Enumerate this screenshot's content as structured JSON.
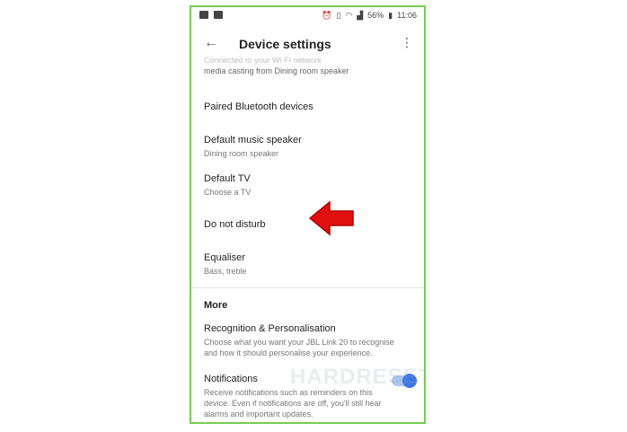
{
  "status": {
    "battery": "56%",
    "time": "11:06"
  },
  "appbar": {
    "title": "Device settings"
  },
  "list": {
    "partial_top_line1": "Connected to your Wi-Fi network",
    "partial_top_line2": "media casting from Dining room speaker",
    "items": [
      {
        "title": "Paired Bluetooth devices",
        "subtitle": ""
      },
      {
        "title": "Default music speaker",
        "subtitle": "Dining room speaker"
      },
      {
        "title": "Default TV",
        "subtitle": "Choose a TV"
      },
      {
        "title": "Do not disturb",
        "subtitle": ""
      },
      {
        "title": "Equaliser",
        "subtitle": "Bass, treble"
      }
    ]
  },
  "more": {
    "section_title": "More",
    "recognition": {
      "title": "Recognition & Personalisation",
      "subtitle": "Choose what you want your JBL Link 20 to recognise and how it should personalise your experience."
    },
    "notifications": {
      "title": "Notifications",
      "subtitle": "Receive notifications such as reminders on this device. Even if notifications are off, you'll still hear alarms and important updates.",
      "enabled": true
    }
  },
  "watermark": {
    "text": "HARDRESET"
  },
  "colors": {
    "frame_border": "#77cc55",
    "arrow": "#e01010",
    "toggle_knob": "#3b78e7"
  }
}
